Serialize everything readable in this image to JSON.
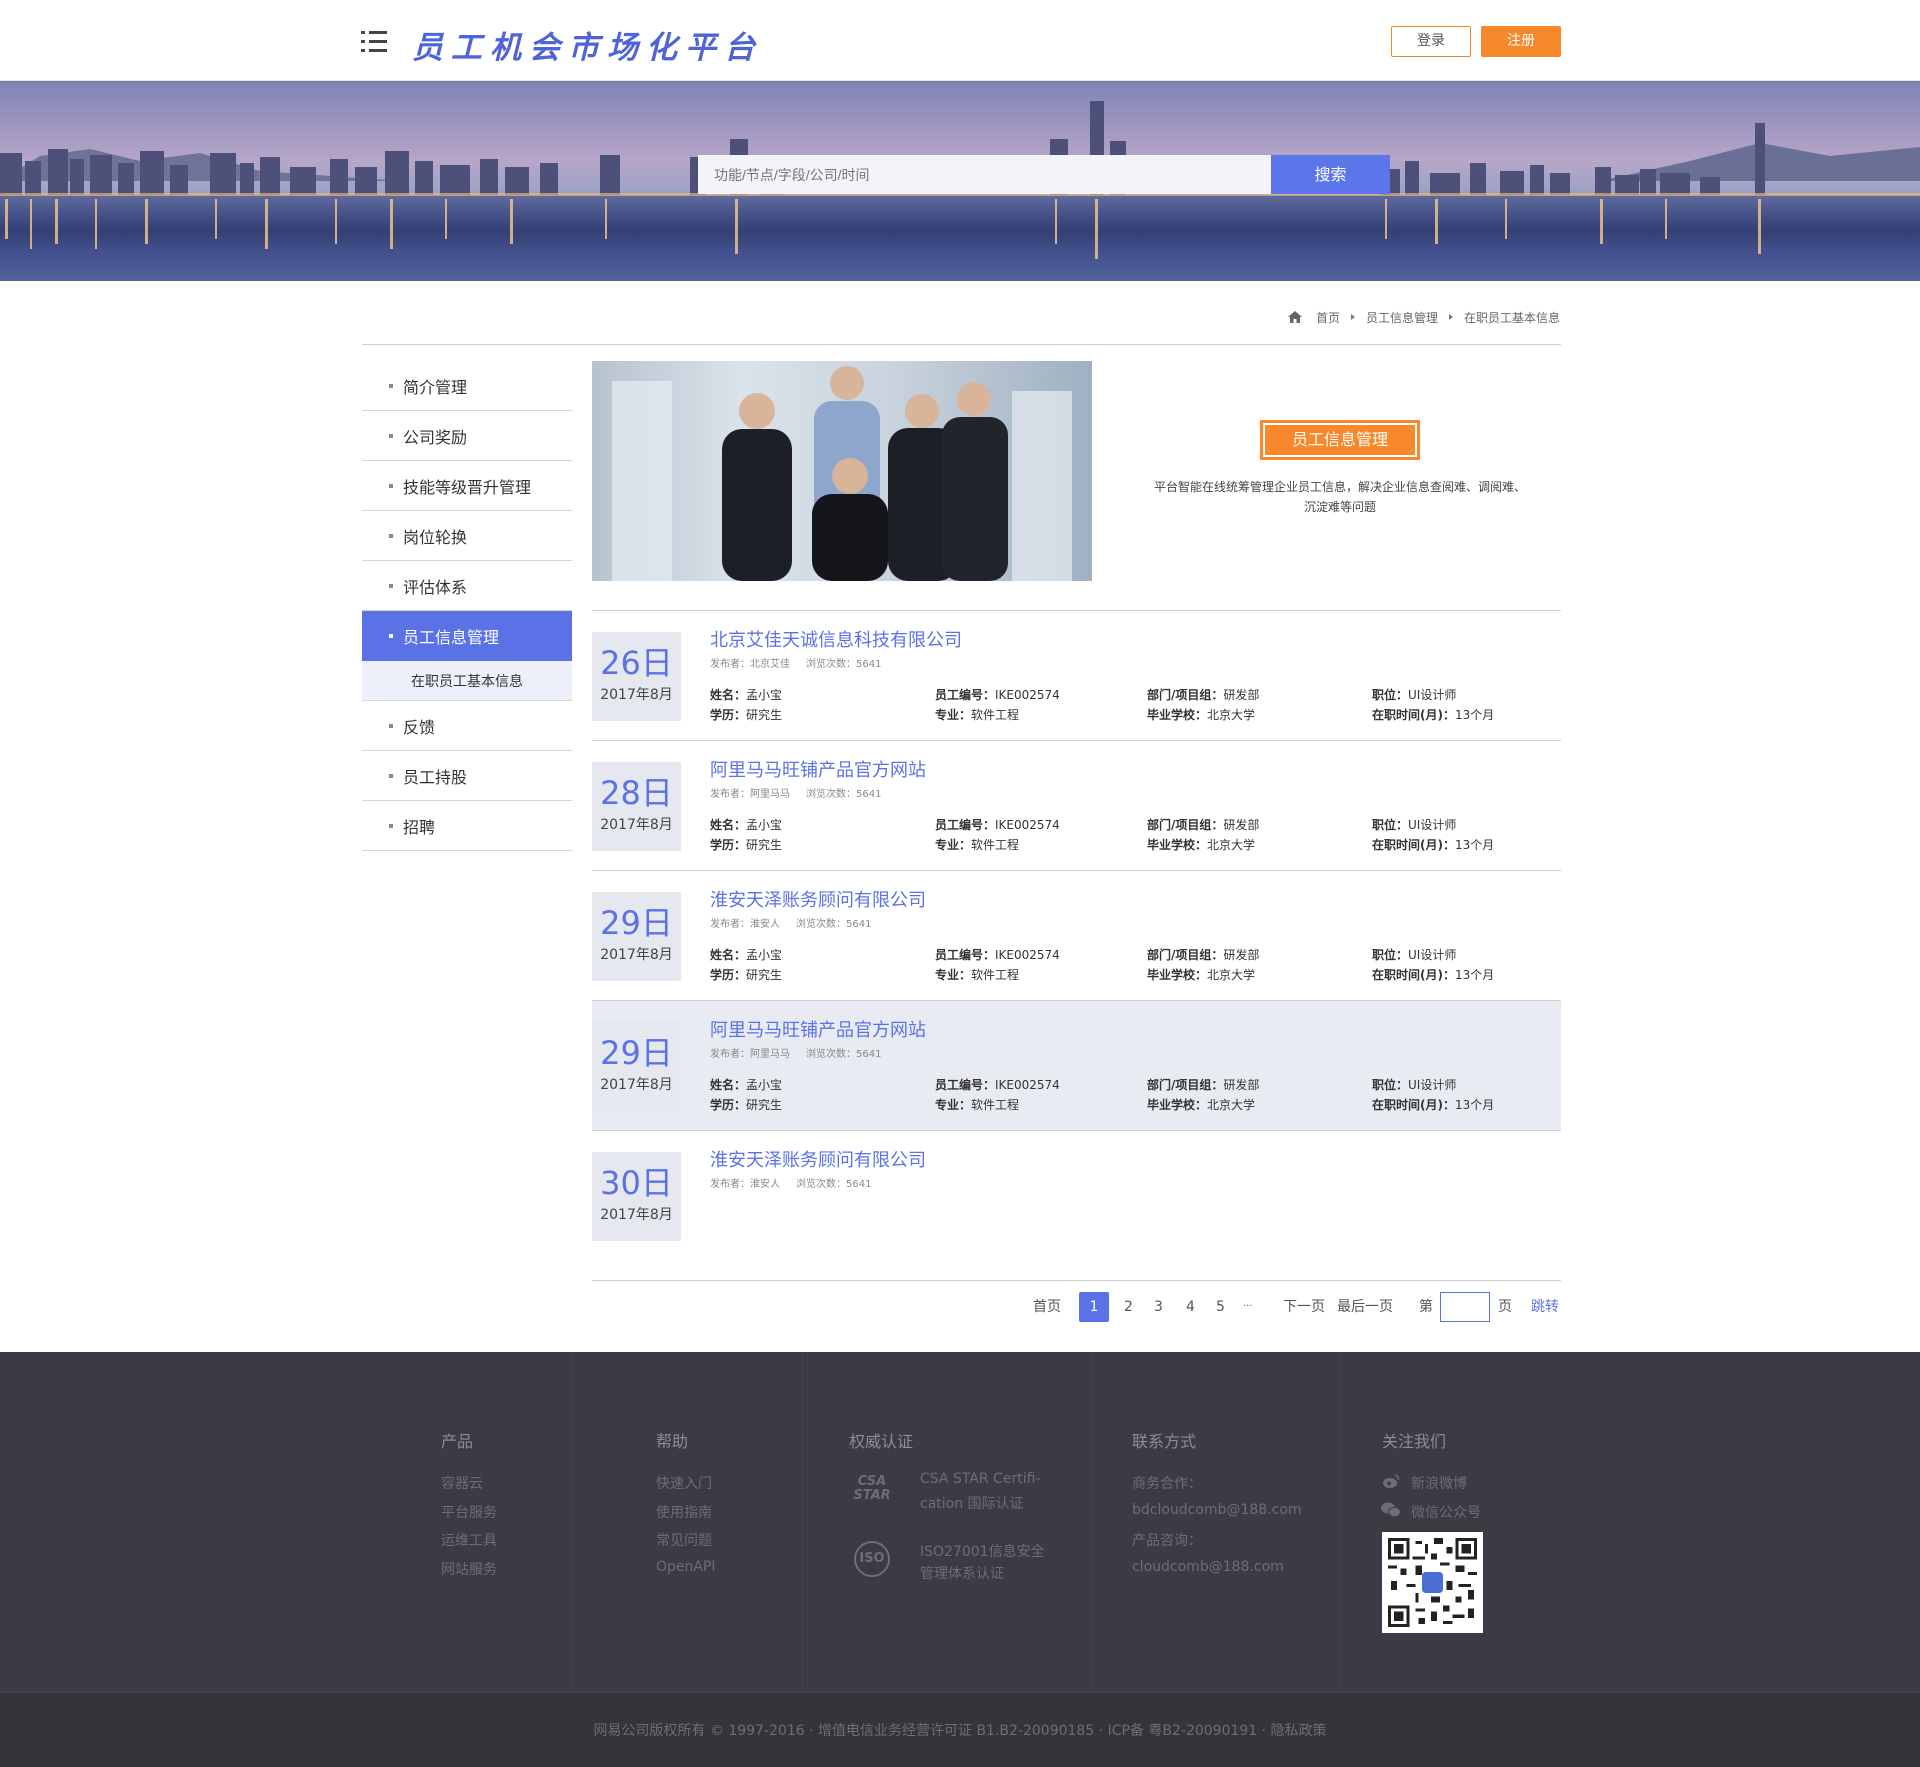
{
  "header": {
    "title": "员工机会市场化平台",
    "login_label": "登录",
    "register_label": "注册"
  },
  "search": {
    "placeholder": "功能/节点/字段/公司/时间",
    "button_label": "搜索"
  },
  "breadcrumb": [
    "首页",
    "员工信息管理",
    "在职员工基本信息"
  ],
  "sidebar": {
    "items": [
      "简介管理",
      "公司奖励",
      "技能等级晋升管理",
      "岗位轮换",
      "评估体系",
      "员工信息管理",
      "反馈",
      "员工持股",
      "招聘"
    ],
    "active_index": 5,
    "sub_item": "在职员工基本信息"
  },
  "intro": {
    "button_label": "员工信息管理",
    "description": "平台智能在线统筹管理企业员工信息，解决企业信息查阅难、调阅难、沉淀难等问题"
  },
  "news": [
    {
      "day": "26日",
      "ym": "2017年8月",
      "title": "北京艾佳天诚信息科技有限公司",
      "publisher": "发布者：北京艾佳",
      "views": "浏览次数：5641",
      "show_fields": true
    },
    {
      "day": "28日",
      "ym": "2017年8月",
      "title": "阿里马马旺铺产品官方网站",
      "publisher": "发布者：阿里马马",
      "views": "浏览次数：5641",
      "show_fields": true
    },
    {
      "day": "29日",
      "ym": "2017年8月",
      "title": "淮安天泽账务顾问有限公司",
      "publisher": "发布者：淮安人",
      "views": "浏览次数：5641",
      "show_fields": true
    },
    {
      "day": "29日",
      "ym": "2017年8月",
      "title": "阿里马马旺铺产品官方网站",
      "publisher": "发布者：阿里马马",
      "views": "浏览次数：5641",
      "show_fields": true,
      "highlight": true
    },
    {
      "day": "30日",
      "ym": "2017年8月",
      "title": "淮安天泽账务顾问有限公司",
      "publisher": "发布者：淮安人",
      "views": "浏览次数：5641",
      "show_fields": false
    }
  ],
  "fields": {
    "name_label": "姓名：",
    "name": "孟小宝",
    "edu_label": "学历：",
    "edu": "研究生",
    "id_label": "员工编号：",
    "id": "IKE002574",
    "major_label": "专业：",
    "major": "软件工程",
    "dept_label": "部门/项目组：",
    "dept": "研发部",
    "school_label": "毕业学校：",
    "school": "北京大学",
    "post_label": "职位：",
    "post": "UI设计师",
    "tenure_label": "在职时间(月)：",
    "tenure": "13个月"
  },
  "pagination": {
    "first": "首页",
    "pages": [
      "1",
      "2",
      "3",
      "4",
      "5"
    ],
    "current": "1",
    "ellipsis": "···",
    "next": "下一页",
    "last": "最后一页",
    "goto_prefix": "第",
    "goto_suffix": "页",
    "jump": "跳转"
  },
  "footer": {
    "products": {
      "heading": "产品",
      "links": [
        "容器云",
        "平台服务",
        "运维工具",
        "网站服务"
      ]
    },
    "help": {
      "heading": "帮助",
      "links": [
        "快速入门",
        "使用指南",
        "常见问题",
        "OpenAPI"
      ]
    },
    "certs": {
      "heading": "权威认证",
      "csa_logo": "CSA STAR",
      "csa_line1": "CSA STAR Certifi-",
      "csa_line2": "cation 国际认证",
      "iso_logo": "ISO",
      "iso_line1": "ISO27001信息安全",
      "iso_line2": "管理体系认证"
    },
    "contact": {
      "heading": "联系方式",
      "lines": [
        "商务合作：",
        "bdcloudcomb@188.com",
        "产品咨询：",
        "cloudcomb@188.com"
      ]
    },
    "follow": {
      "heading": "关注我们",
      "weibo": "新浪微博",
      "wechat": "微信公众号"
    },
    "copyright": "网易公司版权所有 © 1997-2016  ·  增值电信业务经营许可证 B1.B2-20090185  ·  ICP备 粤B2-20090191  ·  隐私政策"
  },
  "colors": {
    "accent": "#5b72e6",
    "orange": "#f7892c",
    "footer_bg": "#3b3b43"
  }
}
